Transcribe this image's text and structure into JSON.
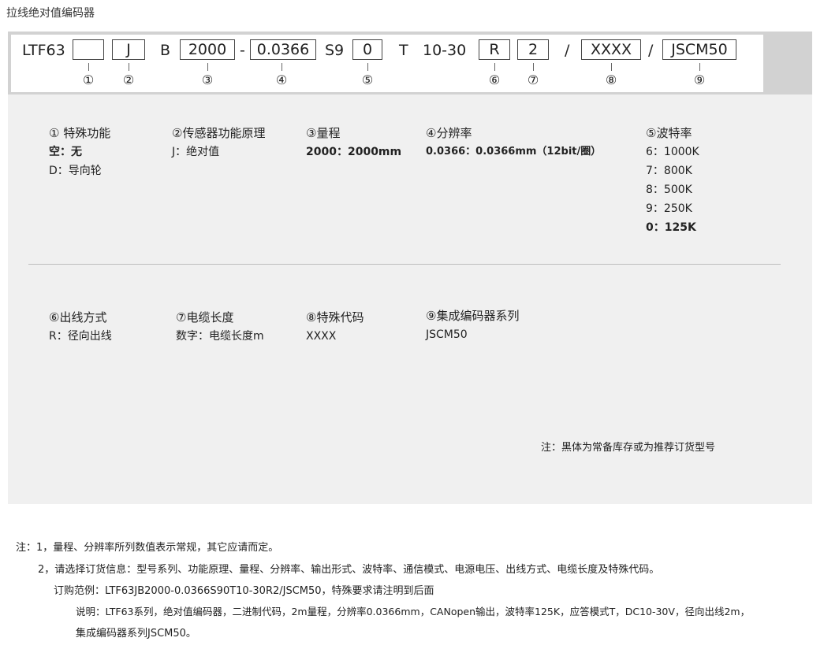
{
  "title": "拉线绝对值编码器",
  "code": {
    "prefix": "LTF63",
    "box1": "",
    "box2": "J",
    "sep_b": "B",
    "box3": "2000",
    "dash": "-",
    "box4": "0.0366",
    "sep_s9": "S9",
    "box5": "0",
    "sep_t": "T",
    "sep_range": "10-30",
    "box6": "R",
    "box7": "2",
    "slash1": "/",
    "box8": "XXXX",
    "slash2": "/",
    "box9": "JSCM50",
    "markers": [
      "①",
      "②",
      "③",
      "④",
      "⑤",
      "⑥",
      "⑦",
      "⑧",
      "⑨"
    ]
  },
  "sections": {
    "s1": {
      "head": "① 特殊功能",
      "lines": [
        "空：无",
        "D：导向轮"
      ]
    },
    "s2": {
      "head": "②传感器功能原理",
      "lines": [
        "J：绝对值"
      ]
    },
    "s3": {
      "head": "③量程",
      "lines": [
        "2000：2000mm"
      ]
    },
    "s4": {
      "head": "④分辨率",
      "lines": [
        "0.0366：0.0366mm（12bit/圈）"
      ]
    },
    "s5": {
      "head": "⑤波特率",
      "lines": [
        "6：1000K",
        "7：800K",
        "8：500K",
        "9：250K",
        "0：125K"
      ]
    },
    "s6": {
      "head": "⑥出线方式",
      "lines": [
        "R：径向出线"
      ]
    },
    "s7": {
      "head": "⑦电缆长度",
      "lines": [
        "数字：电缆长度m"
      ]
    },
    "s8": {
      "head": "⑧特殊代码",
      "lines": [
        "XXXX"
      ]
    },
    "s9": {
      "head": "⑨集成编码器系列",
      "lines": [
        "JSCM50"
      ]
    }
  },
  "note_right": "注：黑体为常备库存或为推荐订货型号",
  "footer": {
    "line1": "注：1，量程、分辨率所列数值表示常规，其它应请而定。",
    "line2": "2，请选择订货信息：型号系列、功能原理、量程、分辨率、输出形式、波特率、通信模式、电源电压、出线方式、电缆长度及特殊代码。",
    "line3": "订购范例：LTF63JB2000-0.0366S90T10-30R2/JSCM50，特殊要求请注明到后面",
    "line4": "说明：LTF63系列，绝对值编码器，二进制代码，2m量程，分辨率0.0366mm，CANopen输出，波特率125K，应答模式T，DC10-30V，径向出线2m，",
    "line5": "集成编码器系列JSCM50。"
  }
}
